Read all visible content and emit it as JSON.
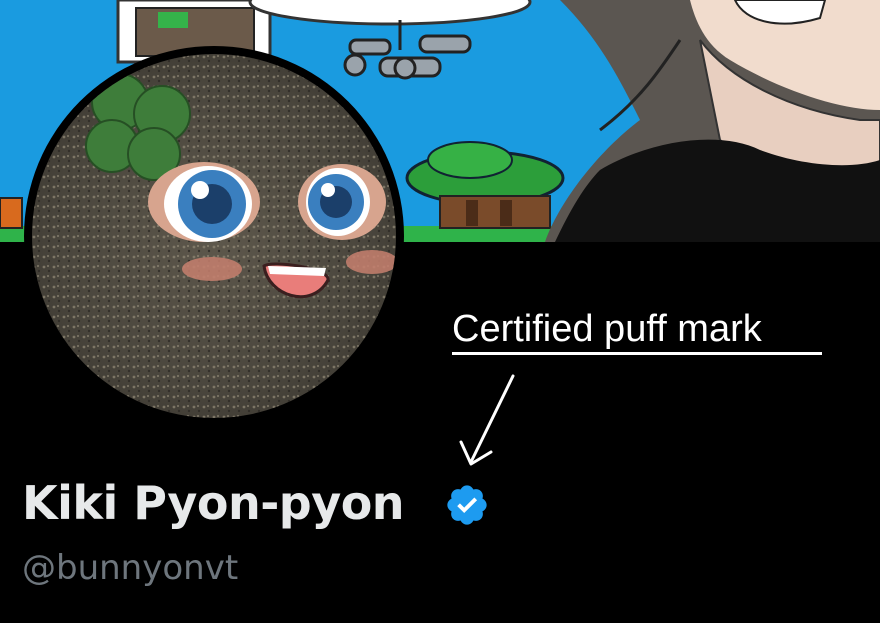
{
  "profile": {
    "display_name": "Kiki Pyon-pyon",
    "handle": "@bunnyonvt"
  },
  "annotation": {
    "text": "Certified puff mark"
  },
  "icons": {
    "verified": "verified-badge-icon",
    "arrow": "arrow-down-left-icon"
  },
  "colors": {
    "page_background": "#000000",
    "banner_sky": "#1a9be0",
    "name_text": "#e7e9ea",
    "handle_text": "#6e767d",
    "verified_badge": "#1d9bf0",
    "annotation_text": "#ffffff"
  }
}
